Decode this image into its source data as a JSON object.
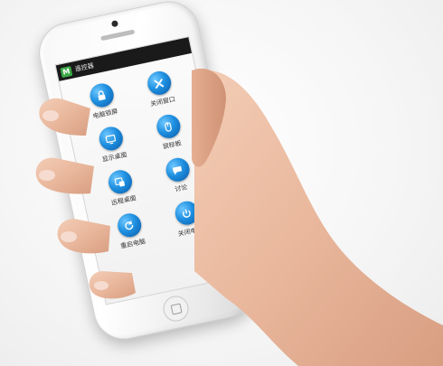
{
  "app": {
    "title": "遥控器",
    "logo_letter": "M"
  },
  "menu": {
    "items": [
      {
        "label": "电脑锁屏",
        "icon": "lock-icon"
      },
      {
        "label": "关闭窗口",
        "icon": "close-window-icon"
      },
      {
        "label": "显示桌面",
        "icon": "desktop-icon"
      },
      {
        "label": "鼠标板",
        "icon": "mouse-pad-icon"
      },
      {
        "label": "远程桌面",
        "icon": "remote-desktop-icon"
      },
      {
        "label": "讨论",
        "icon": "discussion-icon"
      },
      {
        "label": "重启电脑",
        "icon": "restart-icon"
      },
      {
        "label": "关闭电脑",
        "icon": "power-icon"
      }
    ]
  },
  "colors": {
    "icon_blue": "#1e8fe0",
    "statusbar": "#1a1a1a",
    "logo_green": "#3aa845"
  }
}
